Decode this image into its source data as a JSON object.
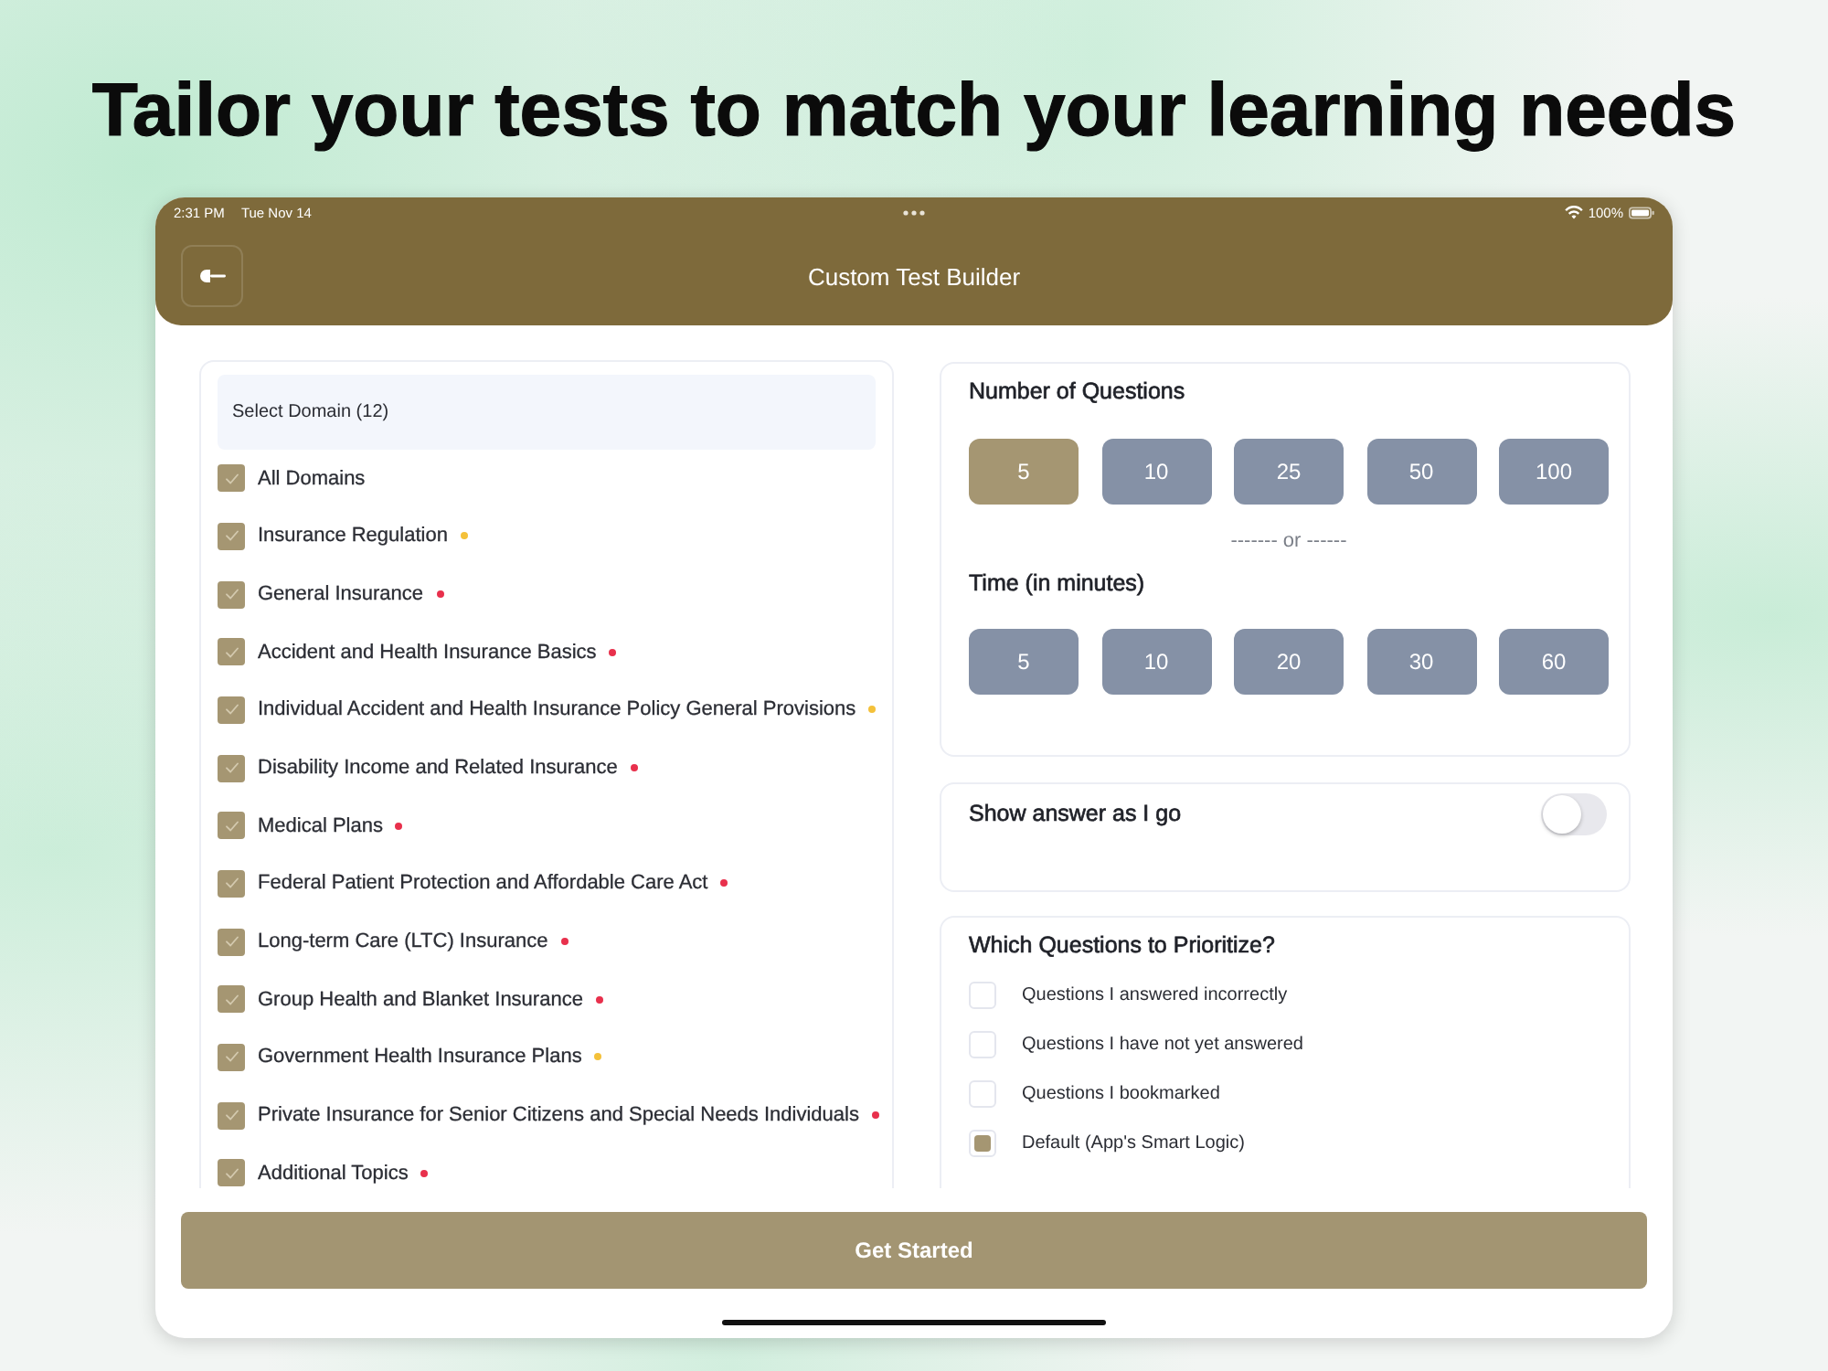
{
  "headline": "Tailor your tests to match your learning needs",
  "status_bar": {
    "time": "2:31 PM",
    "date": "Tue Nov 14",
    "battery": "100%"
  },
  "header": {
    "title": "Custom Test Builder"
  },
  "domains": {
    "title": "Select Domain (12)",
    "items": [
      {
        "label": "All Domains",
        "checked": true
      },
      {
        "label": "Insurance Regulation",
        "checked": true,
        "color": "#f4c13a"
      },
      {
        "label": "General Insurance",
        "checked": true,
        "color": "#e8304c"
      },
      {
        "label": "Accident and Health Insurance Basics",
        "checked": true,
        "color": "#e8304c"
      },
      {
        "label": "Individual Accident and Health Insurance Policy General Provisions",
        "checked": true,
        "color": "#f4c13a"
      },
      {
        "label": "Disability Income and Related Insurance",
        "checked": true,
        "color": "#e8304c"
      },
      {
        "label": "Medical Plans",
        "checked": true,
        "color": "#e8304c"
      },
      {
        "label": "Federal Patient Protection and Affordable Care Act",
        "checked": true,
        "color": "#e8304c"
      },
      {
        "label": "Long-term Care (LTC) Insurance",
        "checked": true,
        "color": "#e8304c"
      },
      {
        "label": "Group Health and Blanket Insurance",
        "checked": true,
        "color": "#e8304c"
      },
      {
        "label": "Government Health Insurance Plans",
        "checked": true,
        "color": "#f4c13a"
      },
      {
        "label": "Private Insurance for Senior Citizens and Special Needs Individuals",
        "checked": true,
        "color": "#e8304c"
      },
      {
        "label": "Additional Topics",
        "checked": true,
        "color": "#e8304c"
      }
    ]
  },
  "question_count": {
    "title": "Number of Questions",
    "options": [
      {
        "label": "5",
        "selected": true
      },
      {
        "label": "10",
        "selected": false
      },
      {
        "label": "25",
        "selected": false
      },
      {
        "label": "50",
        "selected": false
      },
      {
        "label": "100",
        "selected": false
      }
    ]
  },
  "or_divider": "------- or ------",
  "time_limit": {
    "title": "Time (in minutes)",
    "options": [
      {
        "label": "5",
        "selected": false
      },
      {
        "label": "10",
        "selected": false
      },
      {
        "label": "20",
        "selected": false
      },
      {
        "label": "30",
        "selected": false
      },
      {
        "label": "60",
        "selected": false
      }
    ]
  },
  "show_answer": {
    "label": "Show answer as I go",
    "on": false
  },
  "prioritize": {
    "title": "Which Questions to Prioritize?",
    "options": [
      {
        "label": "Questions I answered incorrectly",
        "checked": false
      },
      {
        "label": "Questions I have not yet answered",
        "checked": false
      },
      {
        "label": "Questions I bookmarked",
        "checked": false
      },
      {
        "label": "Default (App's Smart Logic)",
        "checked": true
      }
    ]
  },
  "primary_button": "Get Started"
}
